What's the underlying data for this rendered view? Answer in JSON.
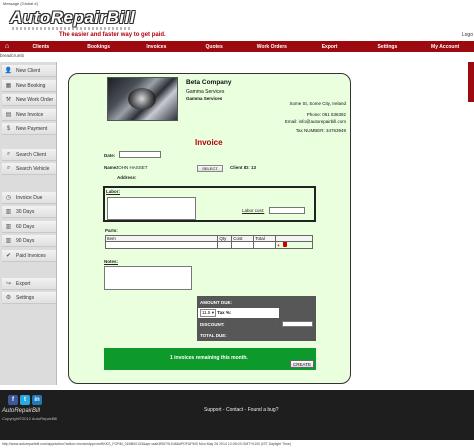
{
  "message_bar": "Message (Global #)",
  "logo_text": "AutoRepairBill",
  "tagline": "The easier and faster way to get paid.",
  "logout_label": "Logo",
  "nav": [
    "Clients",
    "Bookings",
    "Invoices",
    "Quotes",
    "Work Orders",
    "Export",
    "Settings",
    "My Account"
  ],
  "breadcrumb": "breadcrumb",
  "sidebar": [
    {
      "label": "New Client",
      "icon": "person-icon"
    },
    {
      "label": "New Booking",
      "icon": "calendar-icon"
    },
    {
      "label": "New Work Order",
      "icon": "wrench-icon"
    },
    {
      "label": "New Invoice",
      "icon": "document-icon"
    },
    {
      "label": "New Payment",
      "icon": "dollar-icon"
    },
    {
      "label": "Search Client",
      "icon": "magnifier-icon"
    },
    {
      "label": "Search Vehicle",
      "icon": "magnifier-icon"
    },
    {
      "label": "Invoice Due",
      "icon": "clock-icon"
    },
    {
      "label": "30 Days",
      "icon": "page-icon"
    },
    {
      "label": "60 Days",
      "icon": "page-icon"
    },
    {
      "label": "90 Days",
      "icon": "page-icon"
    },
    {
      "label": "Paid Invoices",
      "icon": "check-icon"
    },
    {
      "label": "Export",
      "icon": "arrow-icon"
    },
    {
      "label": "Settings",
      "icon": "gear-icon"
    }
  ],
  "company": {
    "name": "Beta Company",
    "service1": "Gamma Services",
    "service2": "Gamma Services",
    "address": "Some St, Some City, Ireland",
    "phone": "Phone: 061 536392",
    "email": "Email: info@autorepairbill.com",
    "tax": "Tax NUMBER: 34763949"
  },
  "invoice": {
    "title": "Invoice",
    "date_label": "Date:",
    "name_label": "Name:",
    "name_value": "JOHN HASSET",
    "select_label": "SELECT",
    "client_id": "Client ID: 13",
    "address_label": "Address:",
    "labor_label": "Labor:",
    "labor_cost_label": "Labor cost:",
    "parts_label": "Parts:",
    "parts_headers": [
      "Item",
      "Qty",
      "Cost",
      "Total"
    ],
    "notes_label": "Notes:",
    "amount_due_label": "AMOUNT DUE:",
    "tax_select": "11.5",
    "tax_label": "Tax %:",
    "discount_label": "DISCOUNT:",
    "total_due_label": "TOTAL DUE:",
    "remaining_msg": "1 invoices remaining this month.",
    "create_label": "CREATE"
  },
  "footer": {
    "brand": "AutoRepairBill",
    "copyright": "Copyright©2012 AutoRepairBill",
    "links": "Support - Contact - Found a bug?"
  },
  "status_url": "http://www.autorepairbill.com/app/action?action=invoiceApproveBKKS_FORM_01BB00133&apr=aab3f55791048&#PDF&PMS Mon May 26 2014 12:05:03 GMT+0100 (IST Daylight Time)",
  "colors": {
    "brand_red": "#9c0a0f",
    "panel_green": "#eaffde",
    "cta_green": "#0e9a2a"
  }
}
